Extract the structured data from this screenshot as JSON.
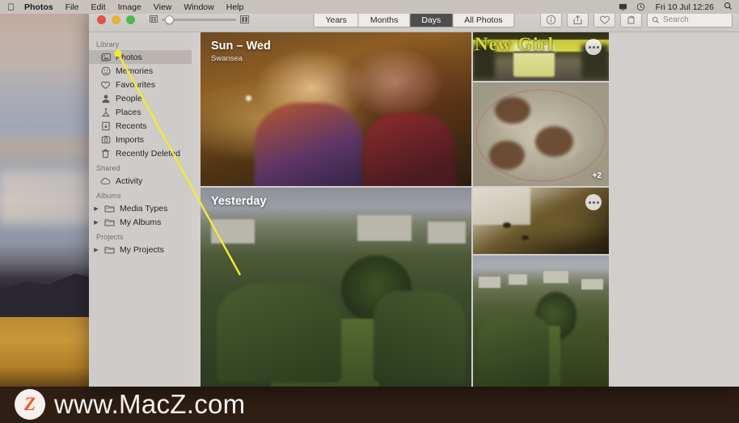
{
  "menubar": {
    "apple_glyph": "●",
    "items": [
      {
        "label": "Photos",
        "bold": true
      },
      {
        "label": "File",
        "bold": false
      },
      {
        "label": "Edit",
        "bold": false
      },
      {
        "label": "Image",
        "bold": false
      },
      {
        "label": "View",
        "bold": false
      },
      {
        "label": "Window",
        "bold": false
      },
      {
        "label": "Help",
        "bold": false
      }
    ],
    "status_icons": [
      "display-icon",
      "siri-icon"
    ],
    "clock": "Fri 10 Jul  12:26",
    "spotlight_glyph": "⌕"
  },
  "window": {
    "title": "Photos",
    "traffic_lights": [
      "close-button",
      "minimize-button",
      "zoom-button"
    ],
    "zoom_slider": {
      "min_icon": "thumbnail-small-icon",
      "max_icon": "thumbnail-large-icon",
      "value": 8
    },
    "view_modes": [
      {
        "label": "Years",
        "active": false
      },
      {
        "label": "Months",
        "active": false
      },
      {
        "label": "Days",
        "active": true
      },
      {
        "label": "All Photos",
        "active": false
      }
    ],
    "toolbar_buttons": [
      {
        "name": "info-button",
        "icon": "info-icon"
      },
      {
        "name": "share-button",
        "icon": "share-icon"
      },
      {
        "name": "favorite-button",
        "icon": "heart-icon"
      },
      {
        "name": "rotate-button",
        "icon": "rotate-icon"
      }
    ],
    "search": {
      "placeholder": "Search",
      "value": "",
      "icon": "search-icon"
    }
  },
  "sidebar": {
    "sections": [
      {
        "header": "Library",
        "items": [
          {
            "label": "Photos",
            "icon": "photos-icon",
            "selected": true,
            "disclosure": false
          },
          {
            "label": "Memories",
            "icon": "memories-icon",
            "selected": false,
            "disclosure": false
          },
          {
            "label": "Favourites",
            "icon": "heart-icon",
            "selected": false,
            "disclosure": false
          },
          {
            "label": "People",
            "icon": "person-icon",
            "selected": false,
            "disclosure": false
          },
          {
            "label": "Places",
            "icon": "pin-icon",
            "selected": false,
            "disclosure": false
          },
          {
            "label": "Recents",
            "icon": "recents-icon",
            "selected": false,
            "disclosure": false
          },
          {
            "label": "Imports",
            "icon": "imports-icon",
            "selected": false,
            "disclosure": false
          },
          {
            "label": "Recently Deleted",
            "icon": "trash-icon",
            "selected": false,
            "disclosure": false
          }
        ]
      },
      {
        "header": "Shared",
        "items": [
          {
            "label": "Activity",
            "icon": "cloud-icon",
            "selected": false,
            "disclosure": false
          }
        ]
      },
      {
        "header": "Albums",
        "items": [
          {
            "label": "Media Types",
            "icon": "folder-icon",
            "selected": false,
            "disclosure": true
          },
          {
            "label": "My Albums",
            "icon": "folder-icon",
            "selected": false,
            "disclosure": true
          }
        ]
      },
      {
        "header": "Projects",
        "items": [
          {
            "label": "My Projects",
            "icon": "folder-icon",
            "selected": false,
            "disclosure": true
          }
        ]
      }
    ]
  },
  "content": {
    "groups": [
      {
        "title": "Sun – Wed",
        "subtitle": "Swansea",
        "more_button": "more-options-button"
      },
      {
        "title": "Yesterday",
        "subtitle": "",
        "more_button": "more-options-button"
      }
    ],
    "thumbnails": [
      {
        "name": "photo-movie-poster",
        "badge": ""
      },
      {
        "name": "photo-new-girl",
        "badge": "",
        "overlay_text": "New Girl"
      },
      {
        "name": "photo-tacos",
        "badge": "+2"
      },
      {
        "name": "photo-garden",
        "badge": ""
      },
      {
        "name": "photo-pastry",
        "badge": ""
      },
      {
        "name": "photo-village",
        "badge": ""
      }
    ]
  },
  "annotation": {
    "callout_label": "Photos",
    "callout_icon": "photos-icon",
    "highlight_color": "#f3ea35",
    "pointer_color": "#f3ea35"
  },
  "watermark": {
    "logo_letter": "Z",
    "text": "www.MacZ.com",
    "logo_color": "#f05a22"
  }
}
